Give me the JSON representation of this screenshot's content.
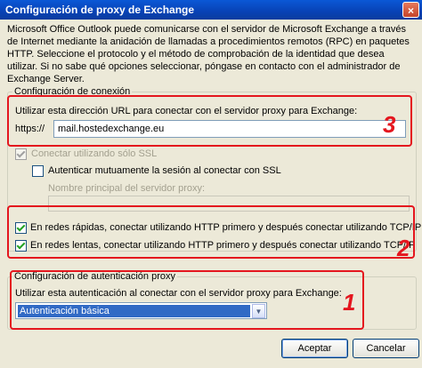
{
  "window": {
    "title": "Configuración de proxy de Exchange",
    "close_glyph": "×"
  },
  "intro": "Microsoft Office Outlook puede comunicarse con el servidor de Microsoft Exchange a través de Internet mediante la anidación de llamadas a procedimientos remotos (RPC) en paquetes HTTP. Seleccione el protocolo y el método de comprobación de la identidad que desea utilizar. Si no sabe qué opciones seleccionar, póngase en contacto con el administrador de Exchange Server.",
  "connection": {
    "legend": "Configuración de conexión",
    "url_label": "Utilizar esta dirección URL para conectar con el servidor proxy para Exchange:",
    "url_prefix": "https://",
    "url_value": "mail.hostedexchange.eu",
    "ssl_only_label": "Conectar utilizando sólo SSL",
    "ssl_only_checked": true,
    "ssl_only_disabled": true,
    "mutual_auth_label": "Autenticar mutuamente la sesión al conectar con SSL",
    "mutual_auth_checked": false,
    "principal_name_label": "Nombre principal del servidor proxy:",
    "principal_name_value": "",
    "fast_networks_label": "En redes rápidas, conectar utilizando HTTP primero y después conectar utilizando TCP/IP",
    "fast_networks_checked": true,
    "slow_networks_label": "En redes lentas, conectar utilizando HTTP primero y después conectar utilizando TCP/IP",
    "slow_networks_checked": true
  },
  "auth": {
    "legend": "Configuración de autenticación proxy",
    "label": "Utilizar esta autenticación al conectar con el servidor proxy para Exchange:",
    "selected": "Autenticación básica",
    "arrow_glyph": "▼"
  },
  "buttons": {
    "accept": "Aceptar",
    "cancel": "Cancelar"
  },
  "annotations": {
    "n1": "1",
    "n2": "2",
    "n3": "3",
    "color": "#e4161e"
  }
}
